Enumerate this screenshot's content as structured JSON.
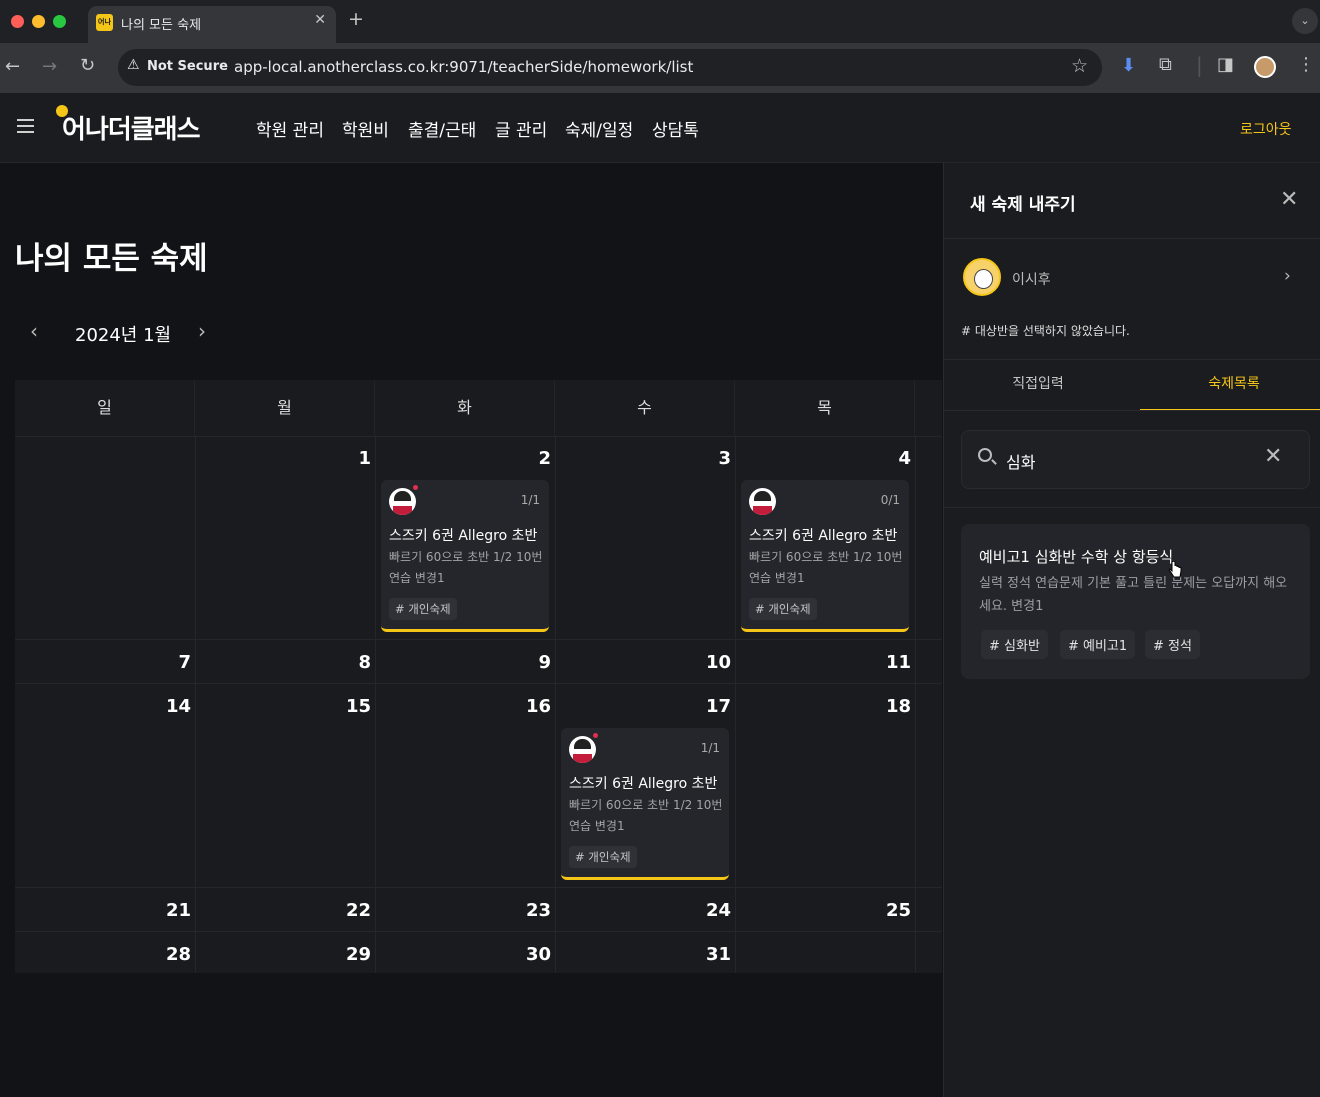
{
  "browser": {
    "tab_title": "나의 모든 숙제",
    "tab_favicon_text": "어나",
    "security_label": "Not Secure",
    "url": "app-local.anotherclass.co.kr:9071/teacherSide/homework/list"
  },
  "header": {
    "logo": "어나더클래스",
    "nav": [
      "학원 관리",
      "학원비",
      "출결/근태",
      "글 관리",
      "숙제/일정",
      "상담톡"
    ],
    "logout": "로그아웃"
  },
  "main": {
    "title": "나의 모든 숙제",
    "month": "2024년 1월"
  },
  "calendar": {
    "weekdays": [
      "일",
      "월",
      "화",
      "수",
      "목"
    ],
    "week1": [
      "1",
      "2",
      "3",
      "4"
    ],
    "week2": [
      "7",
      "8",
      "9",
      "10",
      "11"
    ],
    "week3": [
      "14",
      "15",
      "16",
      "17",
      "18"
    ],
    "week4": [
      "21",
      "22",
      "23",
      "24",
      "25"
    ],
    "week5": [
      "28",
      "29",
      "30",
      "31"
    ],
    "cards": [
      {
        "count": "1/1",
        "title": "스즈키 6권 Allegro 초반",
        "desc": "빠르기 60으로 초반 1/2 10번 연습 변경1",
        "tag": "# 개인숙제"
      },
      {
        "count": "0/1",
        "title": "스즈키 6권 Allegro 초반",
        "desc": "빠르기 60으로 초반 1/2 10번 연습 변경1",
        "tag": "# 개인숙제"
      },
      {
        "count": "1/1",
        "title": "스즈키 6권 Allegro 초반",
        "desc": "빠르기 60으로 초반 1/2 10번 연습 변경1",
        "tag": "# 개인숙제"
      }
    ]
  },
  "panel": {
    "title": "새 숙제 내주기",
    "student_name": "이시후",
    "class_note": "# 대상반을 선택하지 않았습니다.",
    "tabs": [
      "직접입력",
      "숙제목록"
    ],
    "active_tab": "숙제목록",
    "search_value": "심화",
    "result": {
      "title": "예비고1 심화반 수학 상 항등식",
      "desc": "실력 정석 연습문제 기본 풀고 틀린 문제는 오답까지 해오세요. 변경1",
      "tags": [
        "# 심화반",
        "# 예비고1",
        "# 정석"
      ]
    }
  },
  "colors": {
    "accent": "#f5c518",
    "background": "#121316",
    "panel": "#1b1c1f"
  }
}
